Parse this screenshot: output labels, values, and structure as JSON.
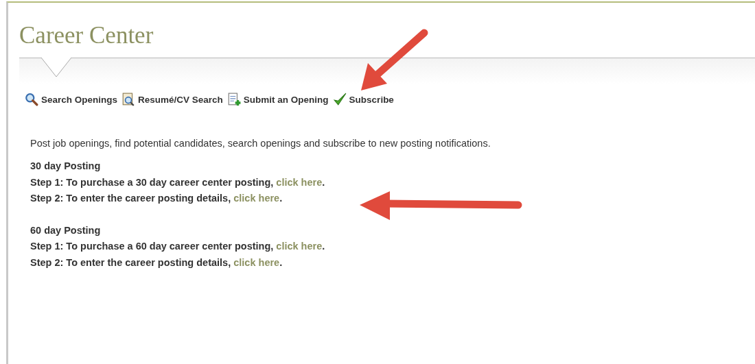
{
  "title": "Career Center",
  "toolbar": [
    {
      "kind": "search",
      "label": "Search Openings"
    },
    {
      "kind": "resume",
      "label": "Resumé/CV Search"
    },
    {
      "kind": "submit",
      "label": "Submit an Opening"
    },
    {
      "kind": "subscribe",
      "label": "Subscribe"
    }
  ],
  "intro": "Post job openings, find potential candidates, search openings and subscribe to new posting notifications.",
  "sections": [
    {
      "heading": "30 day Posting",
      "steps": [
        {
          "text": "Step 1: To purchase a 30 day career center posting, ",
          "link": "click here",
          "end": "."
        },
        {
          "text": "Step 2: To enter the career posting details, ",
          "link": "click here",
          "end": "."
        }
      ]
    },
    {
      "heading": "60 day Posting",
      "steps": [
        {
          "text": "Step 1: To purchase a 60 day career center posting, ",
          "link": "click here",
          "end": "."
        },
        {
          "text": "Step 2: To enter the career posting details, ",
          "link": "click here",
          "end": "."
        }
      ]
    }
  ]
}
